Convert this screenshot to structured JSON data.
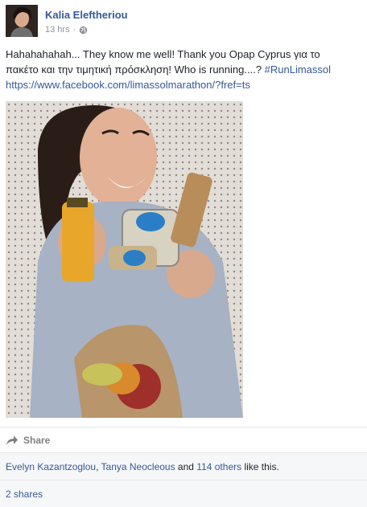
{
  "post": {
    "author": "Kalia Eleftheriou",
    "timestamp": "13 hrs",
    "separator": "·",
    "audience_icon": "globe-icon",
    "text_line1": "Hahahahahah... They know me well! Thank you Opap Cyprus για το",
    "text_line2_a": "πακέτο και την τιμητική πρόσκληση! Who is running....? ",
    "hashtag": "#RunLimassol",
    "link": "https://www.facebook.com/limassolmarathon/?fref=ts"
  },
  "actions": {
    "share_icon": "share-arrow-icon",
    "share_label": "Share"
  },
  "reactions": {
    "liker1": "Evelyn Kazantzoglou",
    "comma": ", ",
    "liker2": "Tanya Neocleous",
    "and": " and ",
    "others": "114 others",
    "suffix": " like this."
  },
  "shares": {
    "label": "2 shares"
  },
  "colors": {
    "link": "#365899",
    "meta": "#90949c",
    "footer_bg": "#f6f7f9"
  }
}
